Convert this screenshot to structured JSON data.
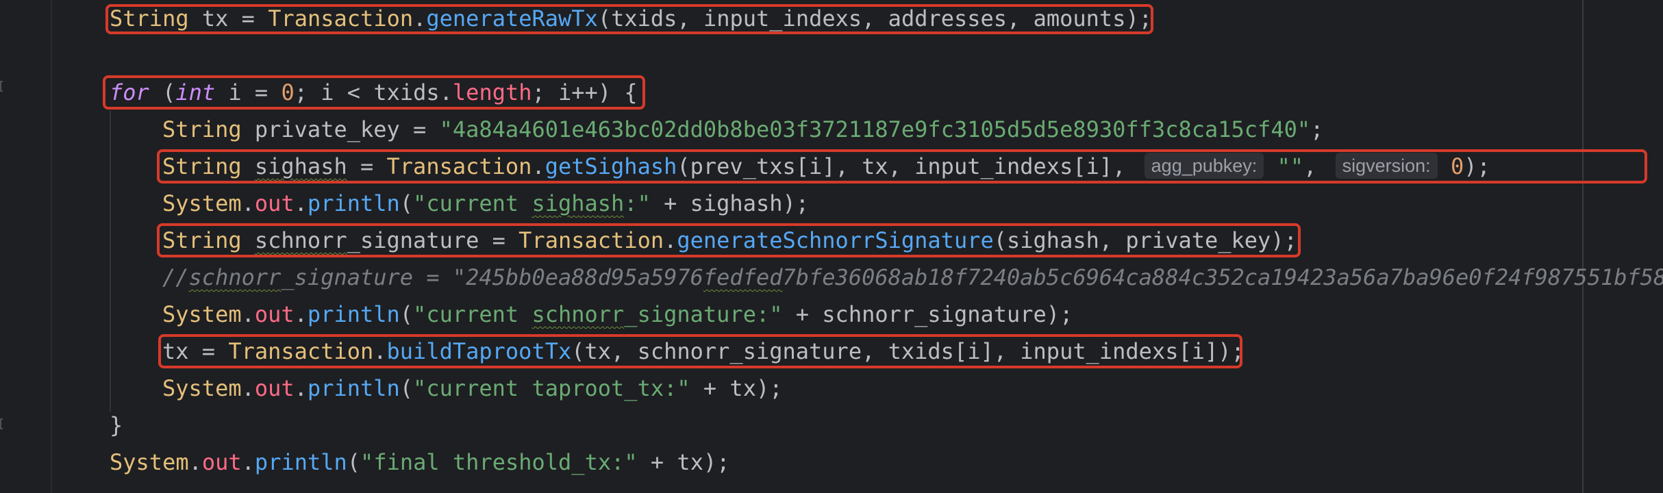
{
  "code": {
    "line1": {
      "t1": "String",
      "t2": " tx = ",
      "t3": "Transaction",
      "t4": ".",
      "t5": "generateRawTx",
      "t6": "(txids, input_indexs, addresses, amounts);"
    },
    "line2": {
      "kw_for": "for",
      "p1": " (",
      "kw_int": "int",
      "p2": " i = ",
      "n0": "0",
      "p3": "; i < txids.",
      "fld": "length",
      "p4": "; i++) {"
    },
    "line3": {
      "t1": "String",
      "t2": " private_key = ",
      "s1": "\"4a84a4601e463bc02dd0b8be03f3721187e9fc3105d5d5e8930ff3c8ca15cf40\"",
      "t3": ";"
    },
    "line4": {
      "t1": "String",
      "t2": " ",
      "v1": "sighash",
      "t3": " = ",
      "t4": "Transaction",
      "t5": ".",
      "m1": "getSighash",
      "t6": "(prev_txs[i], tx, input_indexs[i], ",
      "hint1": "agg_pubkey:",
      "s1": " \"\"",
      "t7": ", ",
      "hint2": "sigversion:",
      "n1": " 0",
      "t8": ");"
    },
    "line5": {
      "t1": "System",
      "t2": ".",
      "f1": "out",
      "t3": ".",
      "m1": "println",
      "t4": "(",
      "s1": "\"current ",
      "s2": "sighash",
      "s3": ":\"",
      "t5": " + sighash);"
    },
    "line6": {
      "t1": "String",
      "t2": " ",
      "v1": "schnorr",
      "v2": "_signature = ",
      "t3": "Transaction",
      "t4": ".",
      "m1": "generateSchnorrSignature",
      "t5": "(sighash, private_key);"
    },
    "line7": {
      "c1": "//",
      "c2": "schnorr",
      "c3": "_signature = \"245bb0ea88d95a5976",
      "c4": "fedfed",
      "c5": "7bfe36068ab18f7240ab5c6964ca884c352ca19423a56a7ba96e0f24f987551bf58"
    },
    "line8": {
      "t1": "System",
      "t2": ".",
      "f1": "out",
      "t3": ".",
      "m1": "println",
      "t4": "(",
      "s1": "\"current ",
      "s2": "schnorr",
      "s3": "_signature:\"",
      "t5": " + schnorr_signature);"
    },
    "line9": {
      "t1": "tx = ",
      "t2": "Transaction",
      "t3": ".",
      "m1": "buildTaprootTx",
      "t4": "(tx, schnorr_signature, txids[i], input_indexs[i]);"
    },
    "line10": {
      "t1": "System",
      "t2": ".",
      "f1": "out",
      "t3": ".",
      "m1": "println",
      "t4": "(",
      "s1": "\"current taproot_tx:\"",
      "t5": " + tx);"
    },
    "line11": {
      "t1": "}"
    },
    "line12": {
      "t1": "System",
      "t2": ".",
      "f1": "out",
      "t3": ".",
      "m1": "println",
      "t4": "(",
      "s1": "\"final threshold_tx:\"",
      "t5": " + tx);"
    }
  }
}
